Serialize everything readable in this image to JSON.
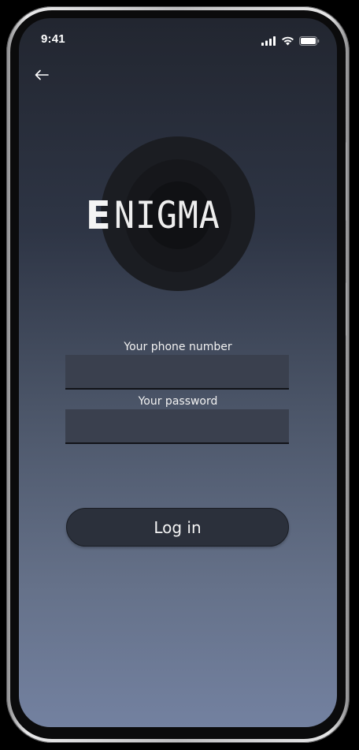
{
  "status_bar": {
    "time": "9:41",
    "icons": [
      "cellular-signal-icon",
      "wifi-icon",
      "battery-icon"
    ]
  },
  "navigation": {
    "back_icon": "arrow-left-icon"
  },
  "logo": {
    "first_letter": "E",
    "rest": "NIGMA"
  },
  "form": {
    "phone_label": "Your phone number",
    "phone_value": "",
    "password_label": "Your password",
    "password_value": ""
  },
  "login_button": {
    "label": "Log in"
  },
  "colors": {
    "gradient_top": "#222630",
    "gradient_bottom": "#7381a0",
    "field_bg": "#3a404e",
    "button_bg": "#2b303b",
    "text": "#f2f2f2"
  }
}
